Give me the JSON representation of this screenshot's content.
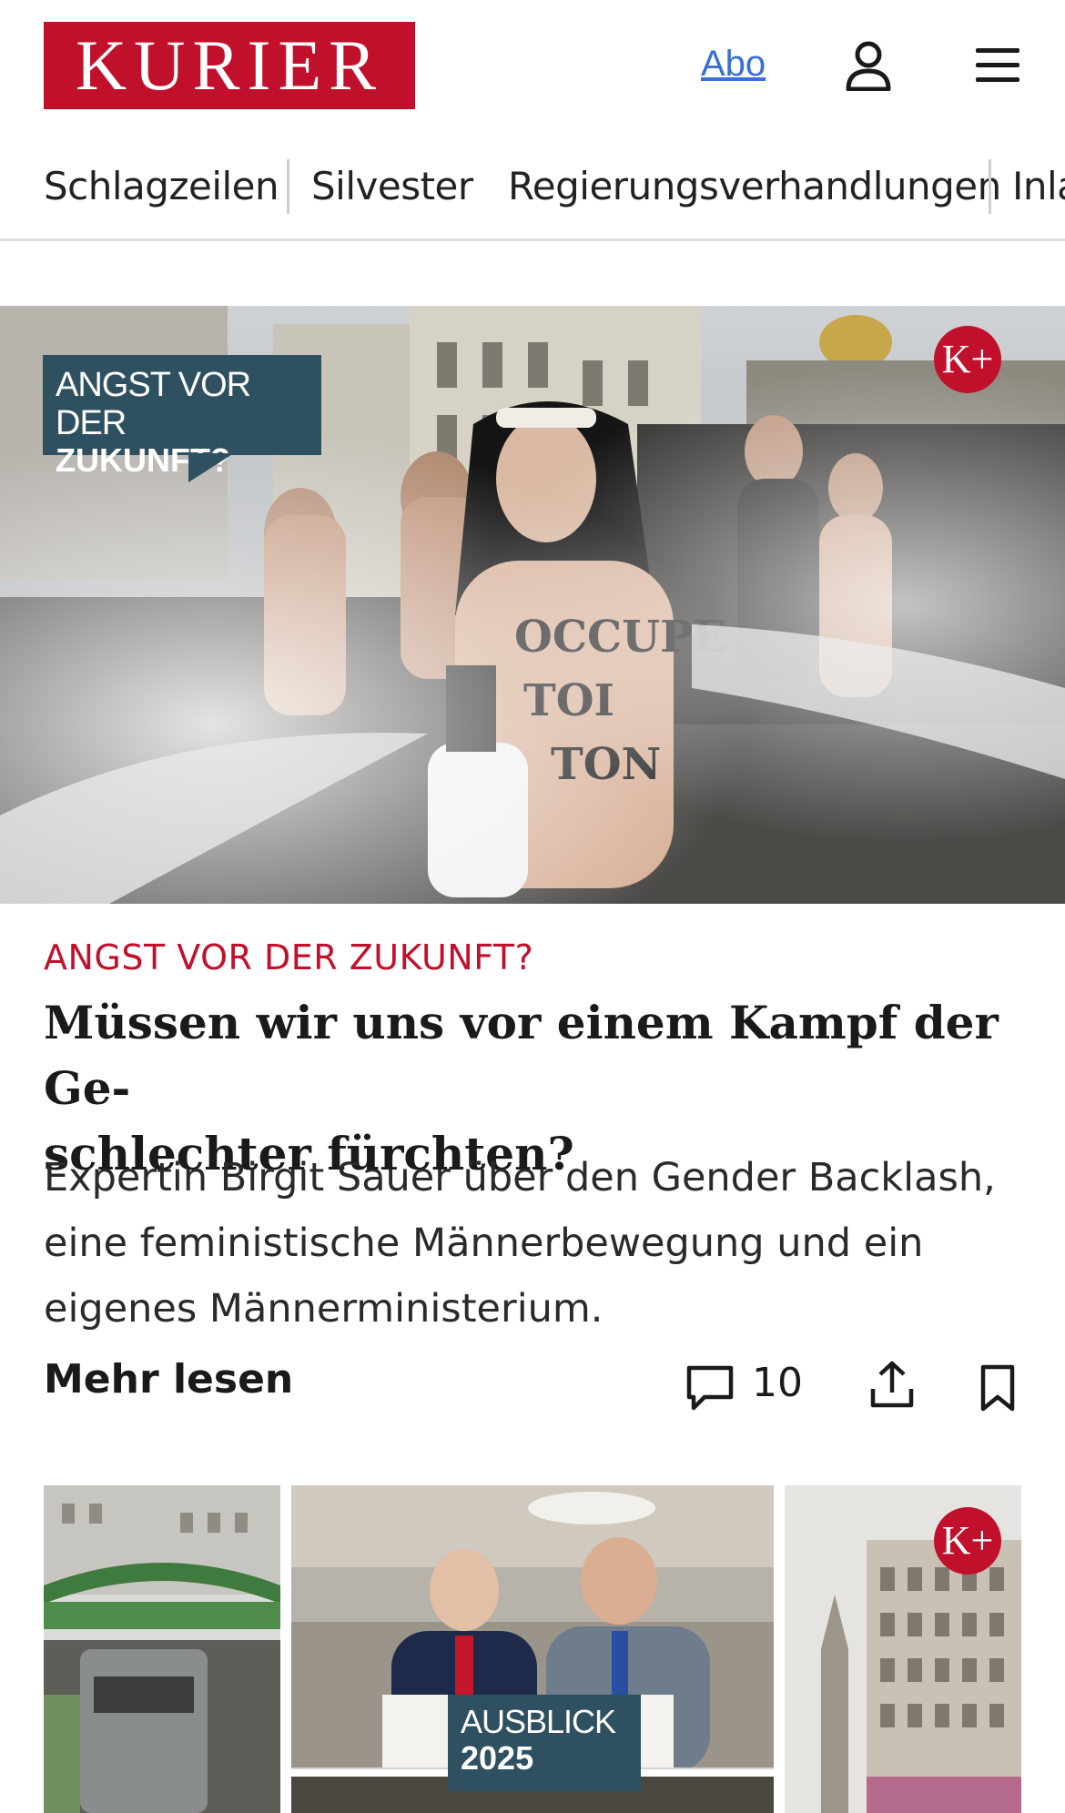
{
  "header": {
    "logo_text": "KURIER",
    "abo_label": "Abo"
  },
  "nav": {
    "items": [
      "Schlagzeilen",
      "Silvester",
      "Regierungsverhandlungen",
      "Inla"
    ]
  },
  "hero": {
    "badge_line1": "ANGST VOR DER",
    "badge_line2": "ZUKUNFT?",
    "premium_badge": "K+"
  },
  "article": {
    "kicker": "ANGST VOR DER ZUKUNFT?",
    "headline_line1": "Müssen wir uns vor einem Kampf der Ge-",
    "headline_line2": "schlechter fürchten?",
    "teaser_line1": "Expertin Birgit Sauer über den Gender Backlash,",
    "teaser_line2": "eine feministische Männerbewegung und ein",
    "teaser_line3": "eigenes Männerministerium.",
    "more_label": "Mehr lesen",
    "comment_count": "10"
  },
  "thumbs": {
    "ausblick_line1": "AUSBLICK",
    "ausblick_line2": "2025",
    "premium_badge": "K+"
  },
  "colors": {
    "brand_red": "#c1102b",
    "badge_teal": "#2f5060",
    "link_blue": "#3a6fd8"
  }
}
